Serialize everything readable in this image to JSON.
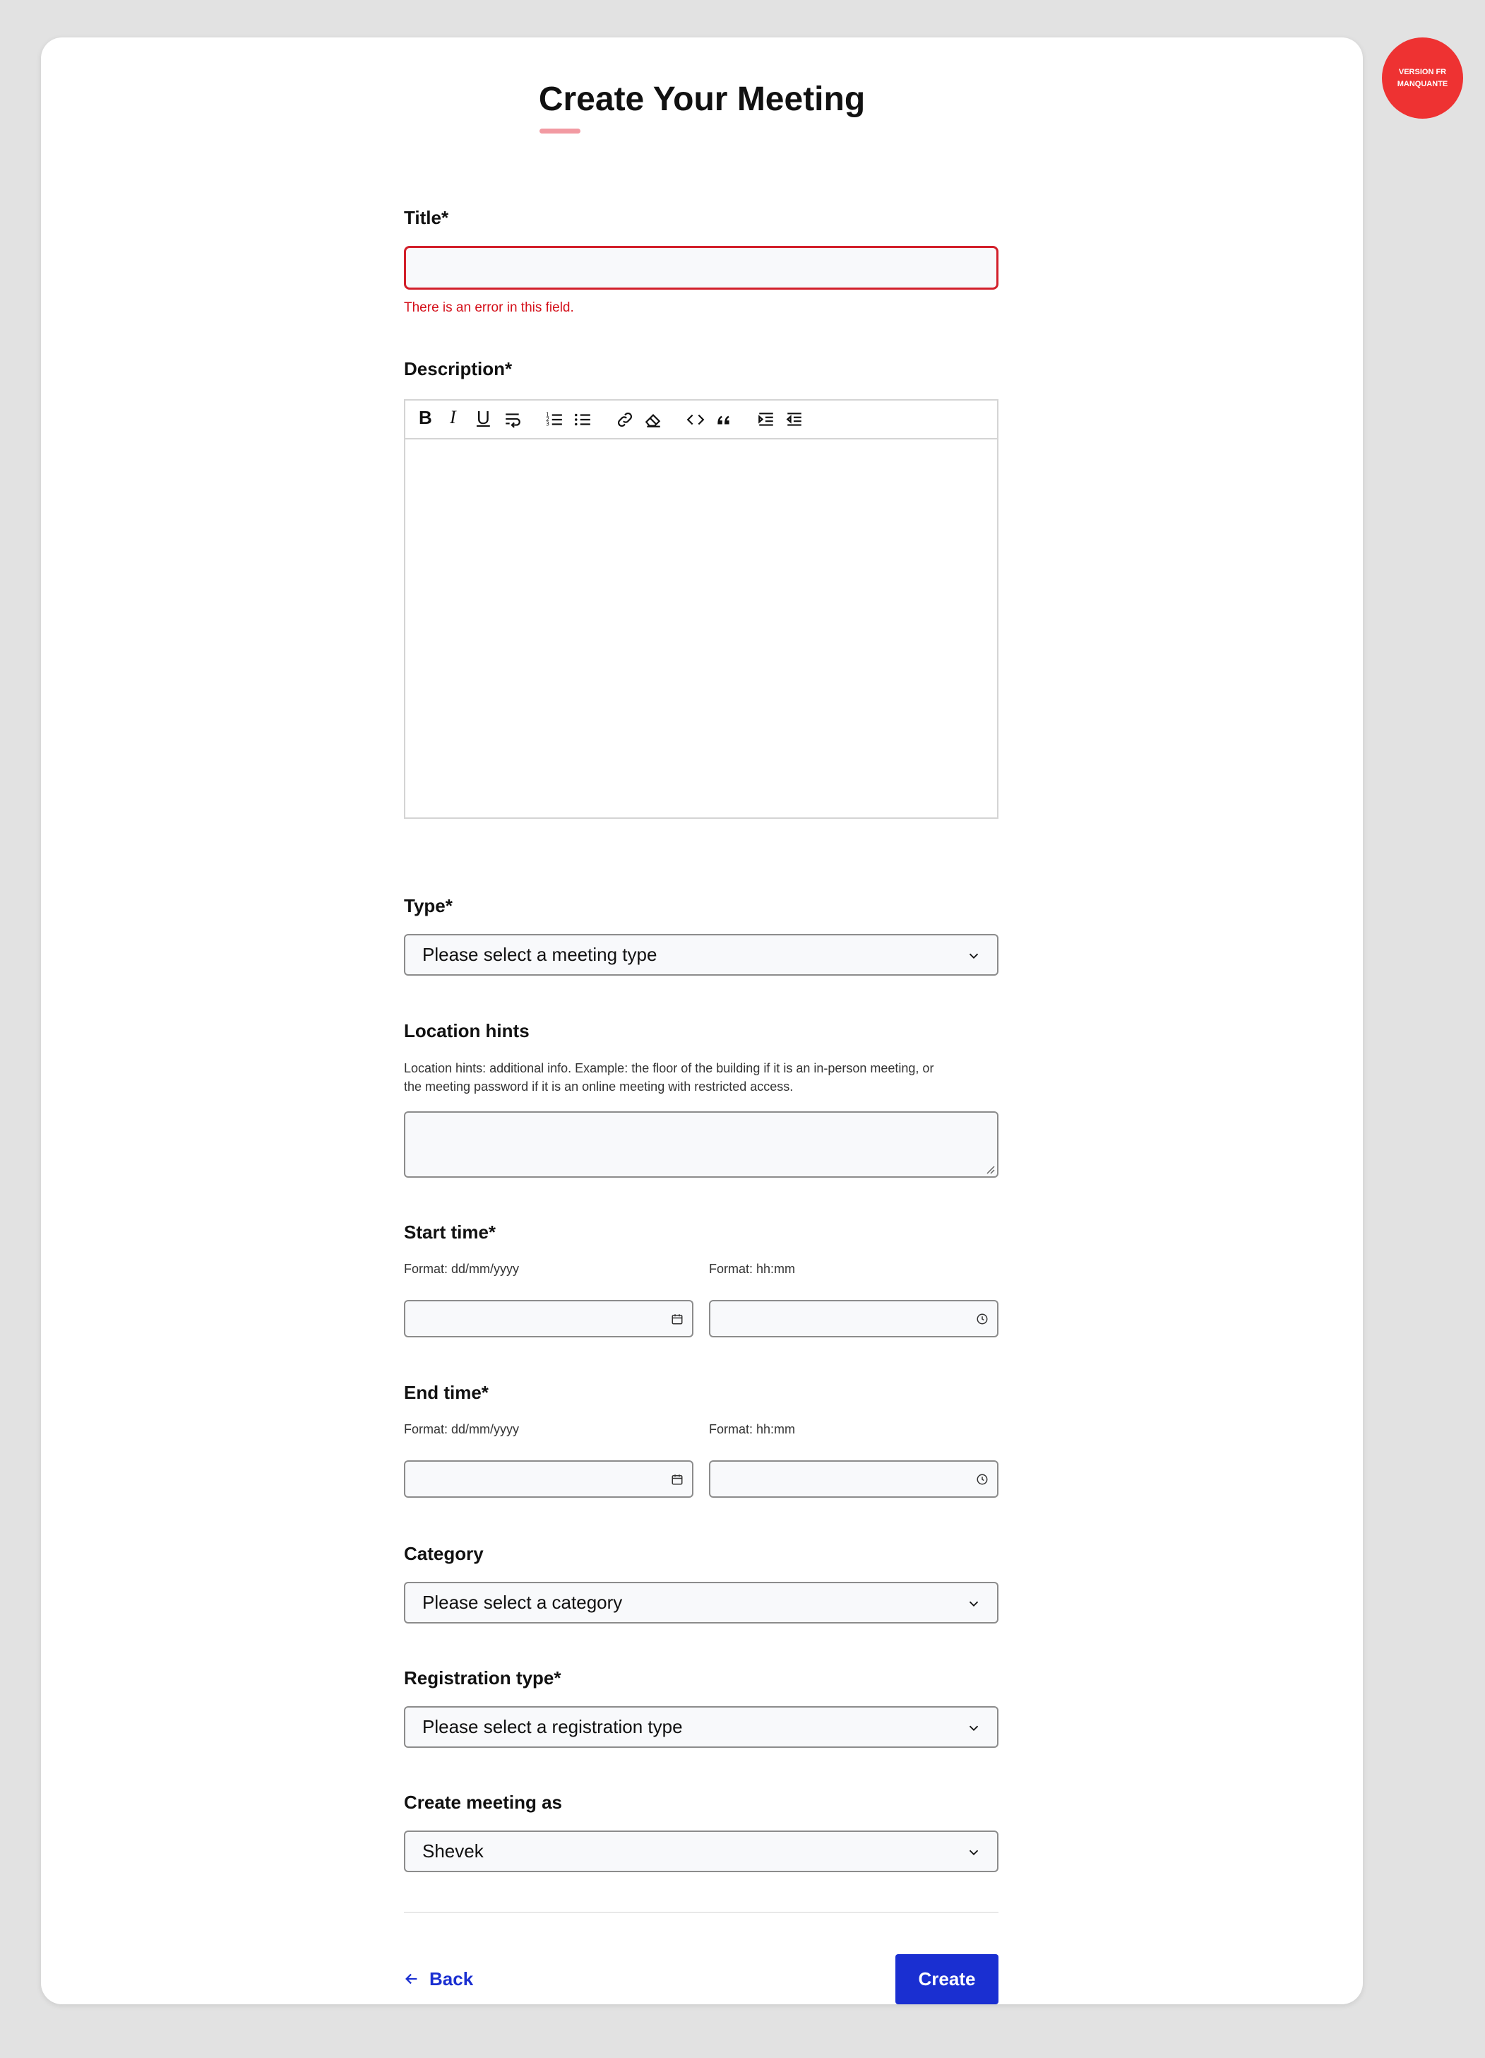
{
  "badge": {
    "line1": "VERSION FR",
    "line2": "MANQUANTE"
  },
  "page": {
    "title": "Create Your Meeting"
  },
  "form": {
    "title": {
      "label": "Title*",
      "value": "",
      "error": "There is an error in this field."
    },
    "description": {
      "label": "Description*"
    },
    "type": {
      "label": "Type*",
      "selected": "Please select a meeting type"
    },
    "location_hints": {
      "label": "Location hints",
      "hint_line1": "Location hints: additional info. Example: the floor of the building if it is an in-person meeting, or",
      "hint_line2": "the meeting password if it is an online meeting with restricted access."
    },
    "start_time": {
      "label": "Start time*",
      "date_format": "Format: dd/mm/yyyy",
      "time_format": "Format: hh:mm"
    },
    "end_time": {
      "label": "End time*",
      "date_format": "Format: dd/mm/yyyy",
      "time_format": "Format: hh:mm"
    },
    "category": {
      "label": "Category",
      "selected": "Please select a category"
    },
    "registration_type": {
      "label": "Registration type*",
      "selected": "Please select a registration type"
    },
    "create_as": {
      "label": "Create meeting as",
      "selected": "Shevek"
    }
  },
  "toolbar": {
    "bold": "B",
    "italic": "I",
    "underline": "U",
    "icons": [
      "hard-break-icon",
      "ordered-list-icon",
      "bullet-list-icon",
      "link-icon",
      "eraser-icon",
      "code-icon",
      "quote-icon",
      "indent-icon",
      "outdent-icon"
    ]
  },
  "actions": {
    "back_label": "Back",
    "create_label": "Create"
  },
  "colors": {
    "primary": "#1a2fd1",
    "error": "#d21f2a",
    "badge": "#ee3232",
    "underline": "#f29aa2"
  }
}
